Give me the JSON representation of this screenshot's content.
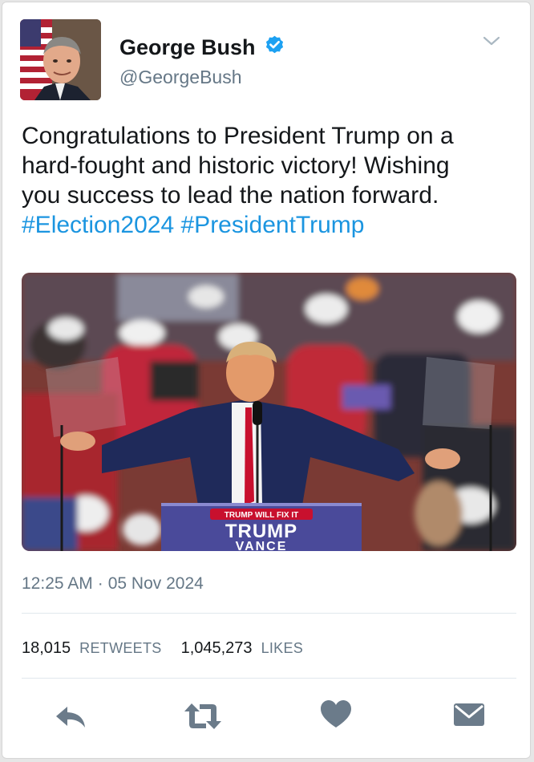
{
  "tweet": {
    "author_name": "George Bush",
    "handle": "@GeorgeBush",
    "text_line1": "Congratulations to President Trump on a",
    "text_line2": "hard-fought and historic victory! Wishing",
    "text_line3": "you success to lead the nation forward.",
    "hashtag1": "#Election2024",
    "hashtag2": "#PresidentTrump",
    "time": "12:25 AM",
    "dot": "·",
    "date": "05 Nov 2024",
    "retweets_count": "18,015",
    "retweets_label": "RETWEETS",
    "likes_count": "1,045,273",
    "likes_label": "LIKES"
  },
  "photo": {
    "sign_small": "TRUMP WILL FIX IT",
    "sign_big": "TRUMP",
    "sign_sub": "VANCE"
  },
  "colors": {
    "accent": "#1b95e0",
    "verified": "#1da1f2",
    "action_icon": "#6b7b8a"
  },
  "icons": {
    "verified": "verified-badge-icon",
    "menu": "chevron-down-icon",
    "reply": "reply-icon",
    "retweet": "retweet-icon",
    "like": "heart-icon",
    "dm": "envelope-icon"
  }
}
